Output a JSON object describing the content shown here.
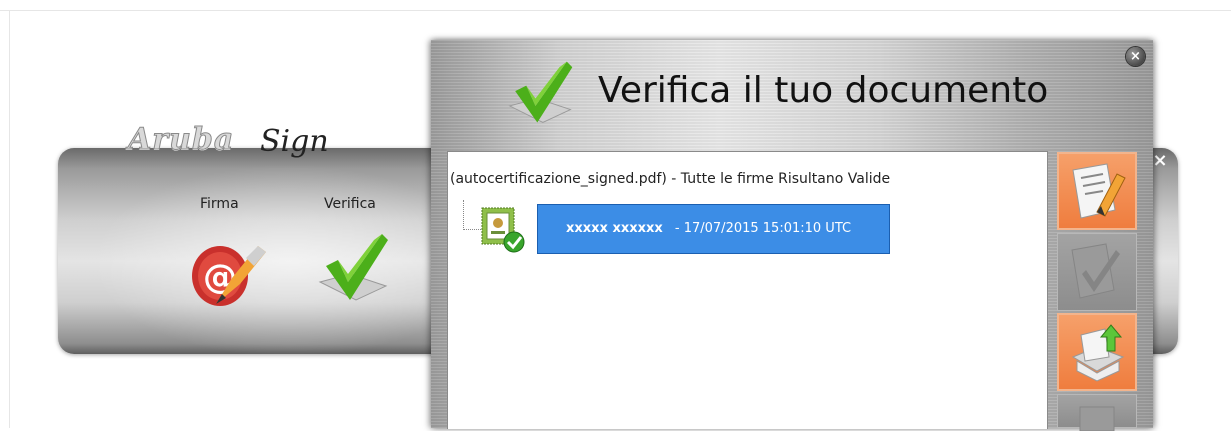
{
  "app": {
    "logo_text": "Aruba",
    "logo_script": "Sign",
    "firma_label": "Firma",
    "verifica_label": "Verifica",
    "panel_close_glyph": "×"
  },
  "dialog": {
    "title": "Verifica il tuo documento",
    "close_glyph": "×",
    "tree_header": "(autocertificazione_signed.pdf) - Tutte le firme Risultano Valide",
    "signature": {
      "signer": "xxxxx xxxxxx",
      "timestamp": " - 17/07/2015 15:01:10 UTC"
    },
    "side_buttons": [
      {
        "icon": "sign-document-icon",
        "state": "active"
      },
      {
        "icon": "verify-document-icon",
        "state": "disabled"
      },
      {
        "icon": "export-document-icon",
        "state": "active"
      },
      {
        "icon": "save-icon",
        "state": "disabled"
      }
    ]
  },
  "colors": {
    "selection": "#3c8de6",
    "accent_orange": "#ef7d3e",
    "check_green": "#4caf1a"
  }
}
